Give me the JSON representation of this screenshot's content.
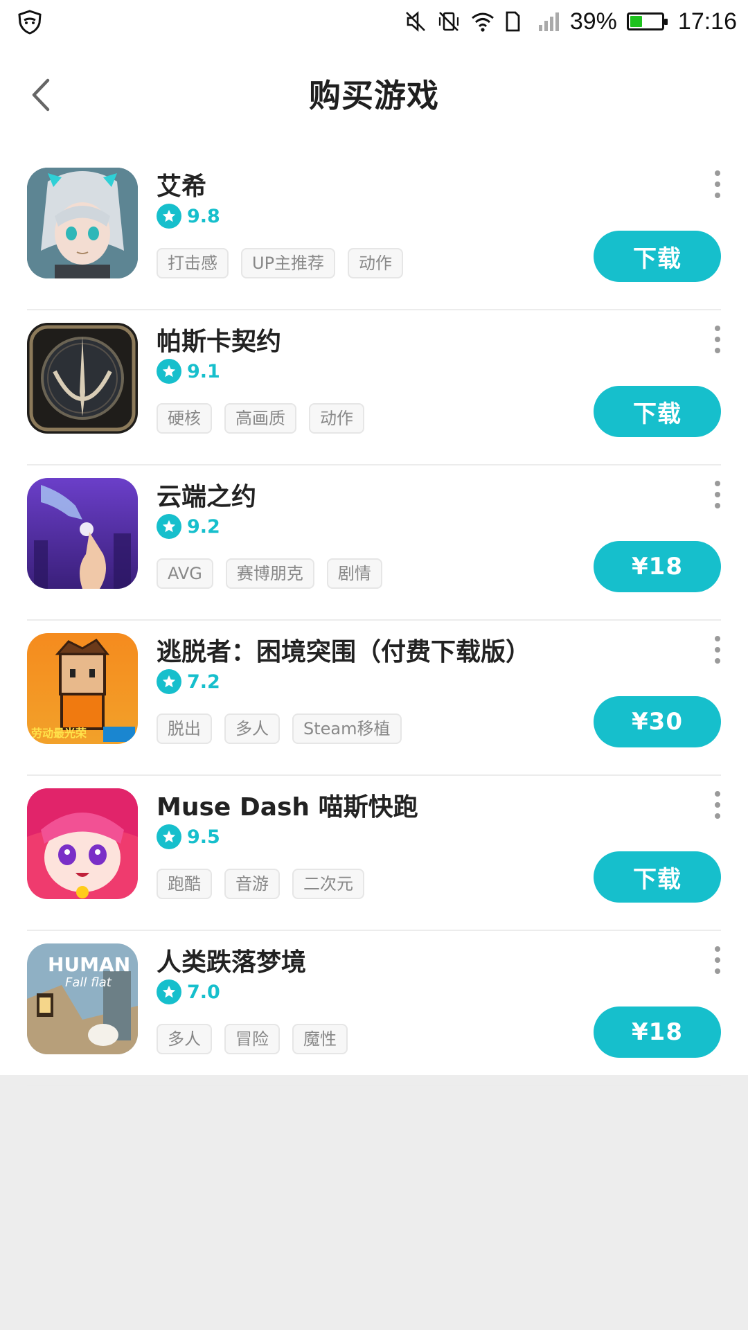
{
  "status_bar": {
    "battery_percent": "39%",
    "battery_level": 0.39,
    "time": "17:16",
    "icons": [
      "privacy-shield-icon",
      "mute-icon",
      "vibrate-off-icon",
      "wifi-icon",
      "sim-icon",
      "signal-icon",
      "battery-icon"
    ]
  },
  "header": {
    "title": "购买游戏",
    "back_icon": "chevron-left-icon"
  },
  "colors": {
    "accent": "#16bfcc",
    "background": "#ffffff",
    "page_bottom": "#ededed",
    "tag_text": "#888888",
    "battery": "#1fc21f"
  },
  "games": [
    {
      "name": "艾希",
      "rating": "9.8",
      "tags": [
        "打击感",
        "UP主推荐",
        "动作"
      ],
      "action": "下载",
      "icon": "anime-girl-icon"
    },
    {
      "name": "帕斯卡契约",
      "rating": "9.1",
      "tags": [
        "硬核",
        "高画质",
        "动作"
      ],
      "action": "下载",
      "icon": "dark-emblem-icon"
    },
    {
      "name": "云端之约",
      "rating": "9.2",
      "tags": [
        "AVG",
        "赛博朋克",
        "剧情"
      ],
      "action": "¥18",
      "icon": "touching-hands-icon"
    },
    {
      "name": "逃脱者：困境突围（付费下载版）",
      "rating": "7.2",
      "tags": [
        "脱出",
        "多人",
        "Steam移植"
      ],
      "action": "¥30",
      "icon": "pixel-prisoner-icon"
    },
    {
      "name": "Muse Dash 喵斯快跑",
      "rating": "9.5",
      "tags": [
        "跑酷",
        "音游",
        "二次元"
      ],
      "action": "下载",
      "icon": "pink-anime-girl-icon"
    },
    {
      "name": "人类跌落梦境",
      "rating": "7.0",
      "tags": [
        "多人",
        "冒险",
        "魔性"
      ],
      "action": "¥18",
      "icon": "human-fall-flat-icon"
    }
  ]
}
